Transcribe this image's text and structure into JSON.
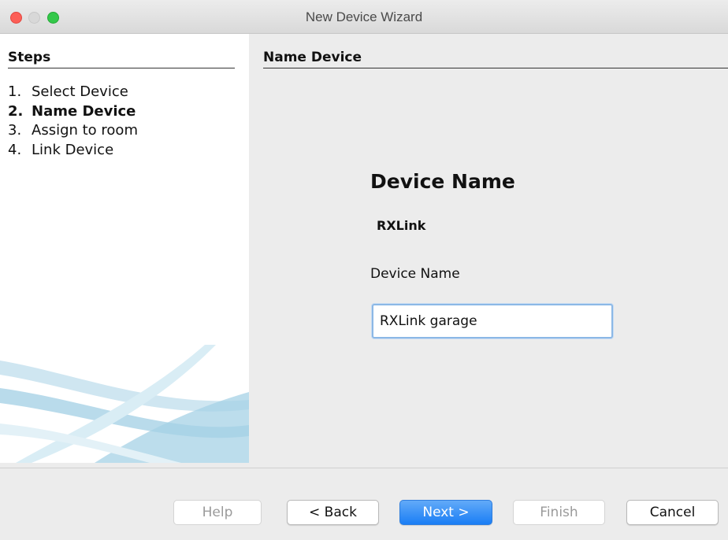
{
  "window": {
    "title": "New Device Wizard"
  },
  "steps": {
    "heading": "Steps",
    "items": [
      {
        "num": "1.",
        "label": "Select Device",
        "active": false
      },
      {
        "num": "2.",
        "label": "Name Device",
        "active": true
      },
      {
        "num": "3.",
        "label": "Assign to room",
        "active": false
      },
      {
        "num": "4.",
        "label": "Link Device",
        "active": false
      }
    ]
  },
  "panel": {
    "heading": "Name Device",
    "title": "Device Name",
    "device_type": "RXLink",
    "field_label": "Device Name",
    "field_value": "RXLink garage"
  },
  "buttons": {
    "help": "Help",
    "back": "< Back",
    "next": "Next >",
    "finish": "Finish",
    "cancel": "Cancel"
  },
  "colors": {
    "accent": "#1a7ef5",
    "focus_ring": "#8cb8e6"
  }
}
